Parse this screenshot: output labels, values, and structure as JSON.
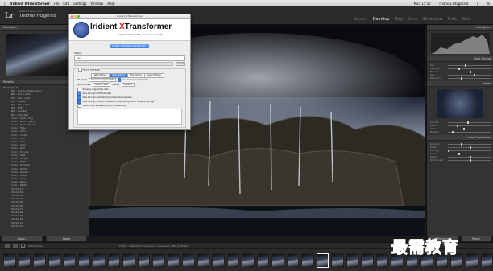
{
  "menubar": {
    "apple_icon": "apple-icon",
    "app_name": "Iridient X-Transformer",
    "items": [
      "File",
      "Edit",
      "Settings",
      "Window",
      "Help"
    ],
    "clock": "Mon 15:57",
    "user": "Thomas Fitzgerald"
  },
  "identity": {
    "logo": "Lr",
    "subtitle": "www.someurl.com",
    "name": "Thomas Fitzgerald"
  },
  "modules": [
    "Library",
    "Develop",
    "Map",
    "Book",
    "Slideshow",
    "Print",
    "Web"
  ],
  "active_module": "Develop",
  "left_panel": {
    "navigator_label": "Navigator",
    "presets_label": "Presets",
    "preset_rows": [
      {
        "label": "Develop 1.0",
        "folder": true
      },
      {
        "label": "BW - Low Contrast Glowy",
        "folder": false
      },
      {
        "label": "BW - Film - Grain",
        "folder": false
      },
      {
        "label": "BW - Hard Light",
        "folder": false
      },
      {
        "label": "BW - Classic",
        "folder": false
      },
      {
        "label": "BW - Silver Tone",
        "folder": false
      },
      {
        "label": "BW - Soft",
        "folder": false
      },
      {
        "label": "BW - Low Key",
        "folder": false
      },
      {
        "label": "BW - High Key",
        "folder": false
      },
      {
        "label": "Color - Light - Airy",
        "folder": false
      },
      {
        "label": "Color - Light - Warm",
        "folder": false
      },
      {
        "label": "Color - Dark - Moody",
        "folder": false
      },
      {
        "label": "Color - Fade",
        "folder": false
      },
      {
        "label": "Color - Vivid",
        "folder": false
      },
      {
        "label": "Color - Cross",
        "folder": false
      },
      {
        "label": "Color - Film",
        "folder": false
      },
      {
        "label": "Color - Soft",
        "folder": false
      },
      {
        "label": "Color - Cool",
        "folder": false
      },
      {
        "label": "Color - Dull",
        "folder": false
      },
      {
        "label": "Color - Punchy",
        "folder": false
      },
      {
        "label": "Color - Split",
        "folder": false
      },
      {
        "label": "Color - Sunset",
        "folder": false
      },
      {
        "label": "Color - Matte",
        "folder": false
      },
      {
        "label": "Color - Summer",
        "folder": false
      },
      {
        "label": "Color - Winter",
        "folder": false
      },
      {
        "label": "Color - Golden",
        "folder": false
      },
      {
        "label": "Color - Muted",
        "folder": false
      },
      {
        "label": "Color - Crisp",
        "folder": false
      },
      {
        "label": "Color - Retro",
        "folder": false
      },
      {
        "label": "Color - Pastel",
        "folder": false
      },
      {
        "label": "Studio 01",
        "folder": false
      },
      {
        "label": "Studio 02",
        "folder": false
      },
      {
        "label": "Studio 03",
        "folder": false
      },
      {
        "label": "Studio 04",
        "folder": false
      },
      {
        "label": "Studio 05",
        "folder": false
      },
      {
        "label": "Studio 06",
        "folder": false
      },
      {
        "label": "Studio 07",
        "folder": false
      },
      {
        "label": "Studio 08",
        "folder": false
      },
      {
        "label": "Studio 09",
        "folder": false
      },
      {
        "label": "Studio 10",
        "folder": false
      },
      {
        "label": "Studio 11",
        "folder": false
      },
      {
        "label": "Studio 12",
        "folder": false
      }
    ],
    "copy_button": "Copy...",
    "paste_button": "Paste"
  },
  "right_panel": {
    "histogram_label": "Histogram",
    "split_toning_label": "Split Toning",
    "detail_label": "Detail",
    "lens_label": "Lens Corrections",
    "slider_labels": [
      "Hue",
      "Saturation",
      "Balance",
      "Hue",
      "Saturation",
      "Amount",
      "Radius",
      "Detail",
      "Masking",
      "Luminance",
      "Detail",
      "Contrast",
      "Color",
      "Detail",
      "Smoothness"
    ],
    "previous_button": "Previous",
    "reset_button": "Reset"
  },
  "toolbar": {
    "soft_proofing": "Soft Proofing",
    "filmstrip_info": "Folder : Waterfall  192 photos / 1 selected / IMG_0042.RAF"
  },
  "filmstrip": {
    "count": 33,
    "selected_index": 21
  },
  "dialog": {
    "window_title": "Iridient X-Transformer",
    "brand_prefix": "Iridient ",
    "brand_x": "X",
    "brand_suffix": "Transformer",
    "tagline": "Fujifilm RAF to DNG conversion utility",
    "register_button": "Unlock / Register X-Transformer...",
    "status_label": "Status",
    "status_value": "Idle",
    "cancel_button": "Cancel",
    "settings_label": "Show Settings",
    "tabs": [
      "RAW Options",
      "DNG Options",
      "File Naming",
      "Save to Folder"
    ],
    "active_tab": "DNG Options",
    "bit_depth_label": "Bit depth:",
    "bit_depth_value": "Same as original RAW",
    "lossless_label": "Use lossless compression",
    "jpeg_preview_label": "JPEG Preview:",
    "jpeg_preview_value": "Medium Size",
    "quality_label": "Quality:",
    "quality_value": "Medium",
    "embed_original": "Preserve original file date",
    "checks": [
      "Pass through EXIF metadata",
      "Pass through manufacturer makernote metadata",
      "Pass through XMP/IPTC metadata     Preserve Lightroom Develop Settings",
      "Embed RAW separate (converts separately)"
    ]
  },
  "watermark": "最需教育"
}
